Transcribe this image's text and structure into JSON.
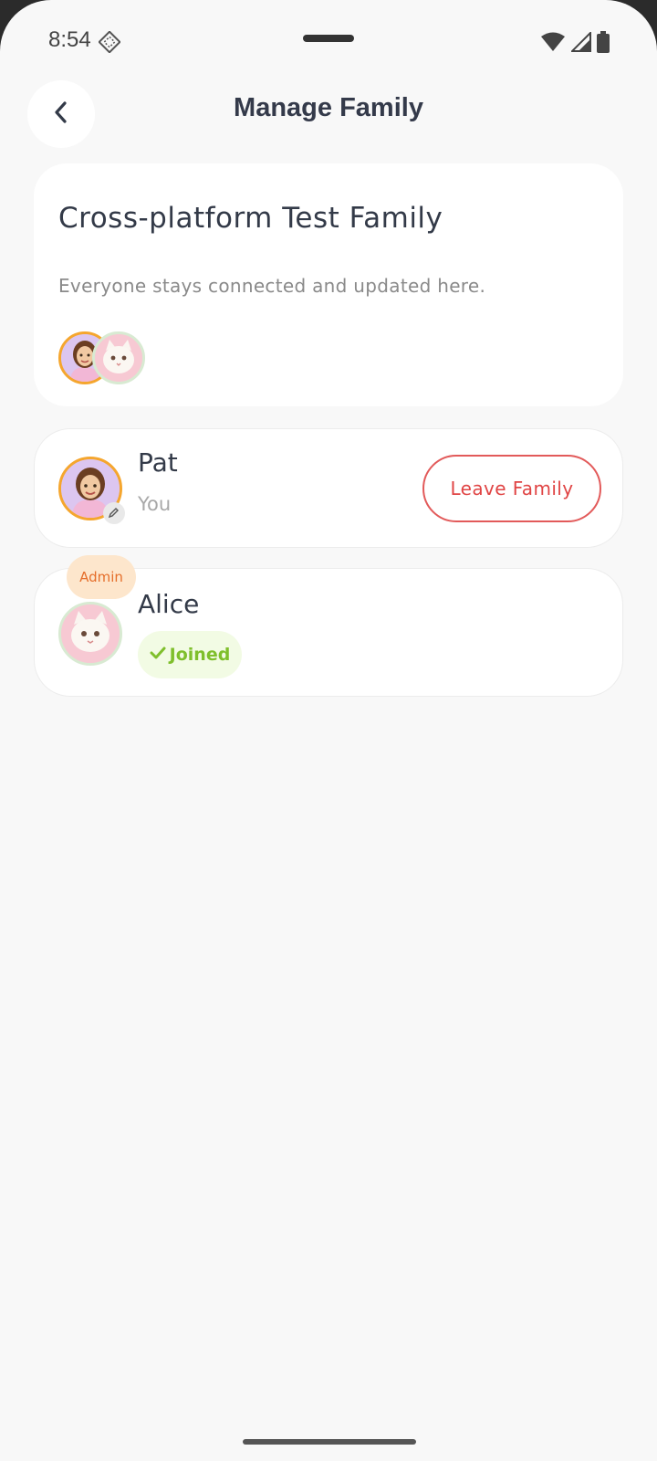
{
  "status_bar": {
    "time": "8:54",
    "icons": [
      "data-saver-icon",
      "wifi-icon",
      "cell-signal-icon",
      "battery-icon"
    ]
  },
  "header": {
    "title": "Manage Family",
    "back_icon": "chevron-left-icon"
  },
  "family": {
    "name": "Cross-platform Test Family",
    "description": "Everyone stays connected and updated here.",
    "avatars": [
      "girl-memoji-avatar",
      "white-cat-avatar"
    ]
  },
  "members": [
    {
      "name": "Pat",
      "subtitle": "You",
      "avatar": "girl-memoji-avatar",
      "action_label": "Leave Family"
    },
    {
      "name": "Alice",
      "role_badge": "Admin",
      "status": "Joined",
      "avatar": "white-cat-avatar"
    }
  ],
  "colors": {
    "background": "#f8f8f8",
    "title": "#343a4a",
    "leave_red": "#e04444",
    "admin_orange": "#e56e2a",
    "admin_bg": "#fde6cc",
    "joined_green": "#7fbf2c",
    "joined_bg": "#f2fbe4",
    "avatar_ring_orange": "#f5a62e"
  }
}
